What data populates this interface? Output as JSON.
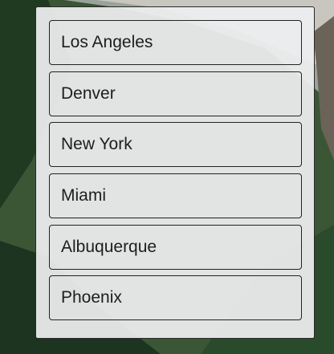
{
  "list": {
    "items": [
      {
        "label": "Los Angeles"
      },
      {
        "label": "Denver"
      },
      {
        "label": "New York"
      },
      {
        "label": "Miami"
      },
      {
        "label": "Albuquerque"
      },
      {
        "label": "Phoenix"
      }
    ]
  }
}
